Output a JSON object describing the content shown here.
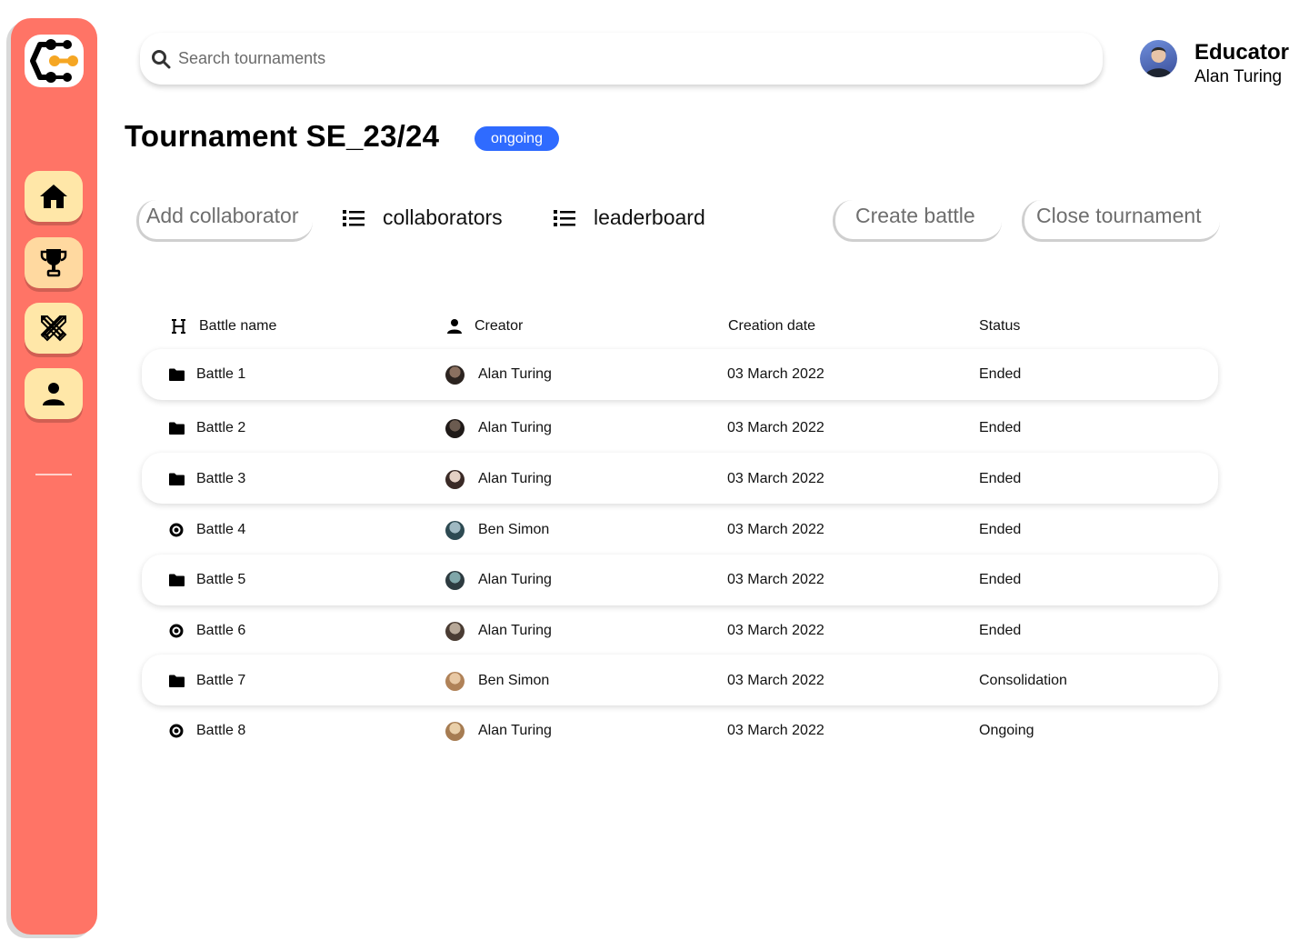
{
  "search": {
    "placeholder": "Search tournaments"
  },
  "user": {
    "role": "Educator",
    "name": "Alan Turing"
  },
  "tournament": {
    "title": "Tournament SE_23/24",
    "status": "ongoing"
  },
  "actions": {
    "add_collaborator": "Add collaborator",
    "collaborators": "collaborators",
    "leaderboard": "leaderboard",
    "create_battle": "Create battle",
    "close_tournament": "Close tournament"
  },
  "table": {
    "headers": {
      "name": "Battle name",
      "creator": "Creator",
      "date": "Creation date",
      "status": "Status"
    },
    "rows": [
      {
        "name": "Battle 1",
        "icon": "folder-icon",
        "creator": "Alan Turing",
        "date": "03 March 2022",
        "status": "Ended"
      },
      {
        "name": "Battle 2",
        "icon": "folder-icon",
        "creator": "Alan Turing",
        "date": "03 March 2022",
        "status": "Ended"
      },
      {
        "name": "Battle 3",
        "icon": "folder-icon",
        "creator": "Alan Turing",
        "date": "03 March 2022",
        "status": "Ended"
      },
      {
        "name": "Battle 4",
        "icon": "target-icon",
        "creator": "Ben Simon",
        "date": "03 March 2022",
        "status": "Ended"
      },
      {
        "name": "Battle 5",
        "icon": "folder-icon",
        "creator": "Alan Turing",
        "date": "03 March 2022",
        "status": "Ended"
      },
      {
        "name": "Battle 6",
        "icon": "target-icon",
        "creator": "Alan Turing",
        "date": "03 March 2022",
        "status": "Ended"
      },
      {
        "name": "Battle 7",
        "icon": "folder-icon",
        "creator": "Ben Simon",
        "date": "03 March 2022",
        "status": "Consolidation"
      },
      {
        "name": "Battle 8",
        "icon": "target-icon",
        "creator": "Alan Turing",
        "date": "03 March 2022",
        "status": "Ongoing"
      }
    ]
  },
  "colors": {
    "sidebar": "#ff7466",
    "nav_button": "#ffe7a8",
    "badge": "#2f6bff",
    "logo_accent": "#f5a623"
  }
}
